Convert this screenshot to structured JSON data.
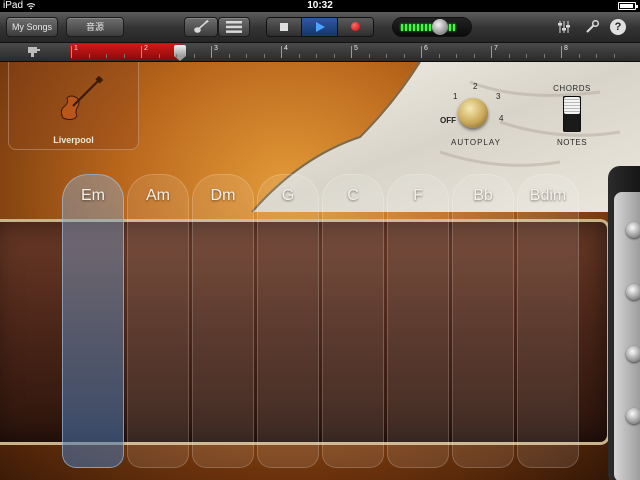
{
  "status_bar": {
    "device": "iPad",
    "time": "10:32",
    "battery_level": 0.9
  },
  "toolbar": {
    "my_songs_label": "My Songs",
    "sound_label": "音源",
    "instrument_icon": "guitar-icon",
    "tracks_icon": "track-list-icon",
    "mixer_icon": "mixer-sliders-icon",
    "settings_icon": "wrench-icon",
    "help_label": "?",
    "volume_level": 0.62
  },
  "ruler": {
    "bars": [
      "1",
      "2",
      "3",
      "4",
      "5",
      "6",
      "7",
      "8"
    ],
    "loop_region_color": "#c01414"
  },
  "instrument": {
    "name": "Liverpool",
    "autoplay": {
      "label": "AUTOPLAY",
      "off_label": "OFF",
      "positions": [
        "1",
        "2",
        "3",
        "4"
      ]
    },
    "mode_switch": {
      "top_label": "CHORDS",
      "bottom_label": "NOTES",
      "selected": "NOTES"
    },
    "chords": [
      {
        "label": "Em",
        "active": true
      },
      {
        "label": "Am",
        "active": false
      },
      {
        "label": "Dm",
        "active": false
      },
      {
        "label": "G",
        "active": false
      },
      {
        "label": "C",
        "active": false
      },
      {
        "label": "F",
        "active": false
      },
      {
        "label": "Bb",
        "active": false
      },
      {
        "label": "Bdim",
        "active": false
      }
    ]
  },
  "colors": {
    "play_button": "#2c5aa0",
    "record_dot": "#e00000",
    "meter_led": "#3cff3c",
    "sunburst": "#e39a38"
  }
}
